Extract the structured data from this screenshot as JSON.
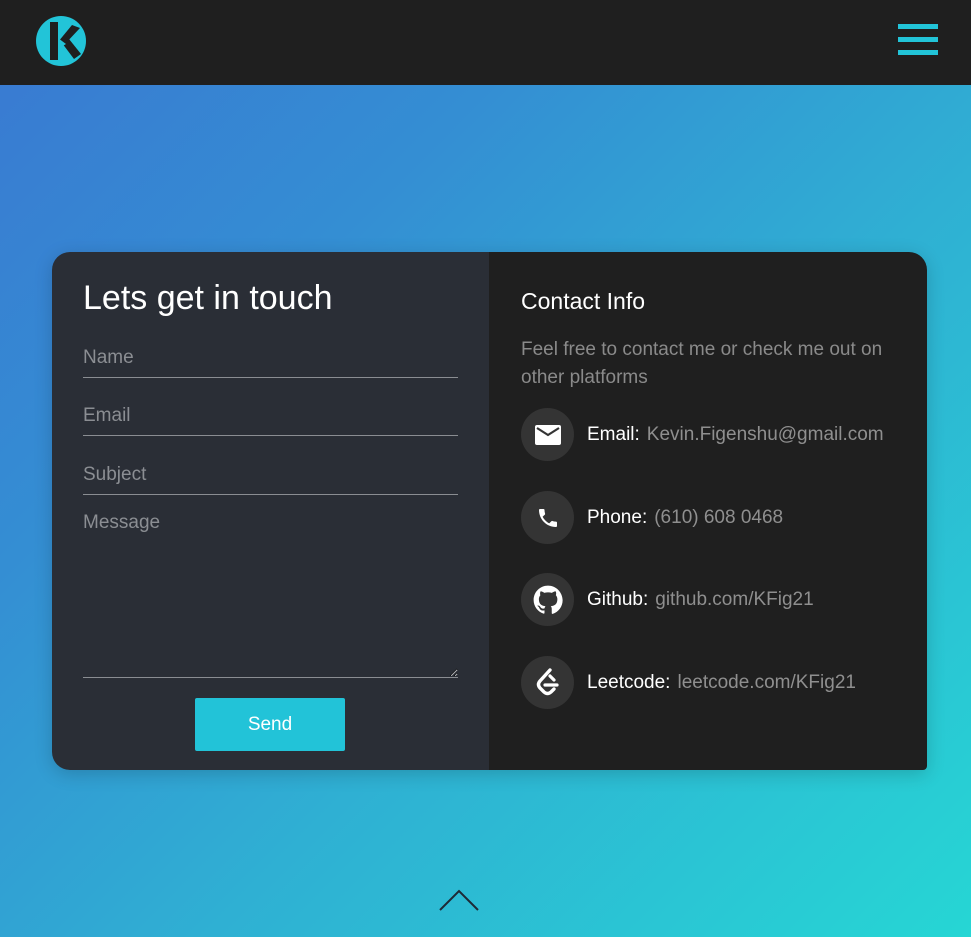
{
  "header": {
    "logo_icon": "k-logo-icon",
    "menu_icon": "hamburger-menu-icon",
    "accent_color": "#22c4d8"
  },
  "form": {
    "title": "Lets get in touch",
    "name_placeholder": "Name",
    "email_placeholder": "Email",
    "subject_placeholder": "Subject",
    "message_placeholder": "Message",
    "send_label": "Send"
  },
  "contact": {
    "title": "Contact Info",
    "description": "Feel free to contact me or check me out on other platforms",
    "items": [
      {
        "icon": "mail-icon",
        "label": "Email:",
        "value": "Kevin.Figenshu@gmail.com"
      },
      {
        "icon": "phone-icon",
        "label": "Phone:",
        "value": "(610) 608 0468"
      },
      {
        "icon": "github-icon",
        "label": "Github:",
        "value": "github.com/KFig21"
      },
      {
        "icon": "leetcode-icon",
        "label": "Leetcode:",
        "value": "leetcode.com/KFig21"
      }
    ]
  },
  "footer": {
    "scroll_up_icon": "chevron-up-icon"
  }
}
